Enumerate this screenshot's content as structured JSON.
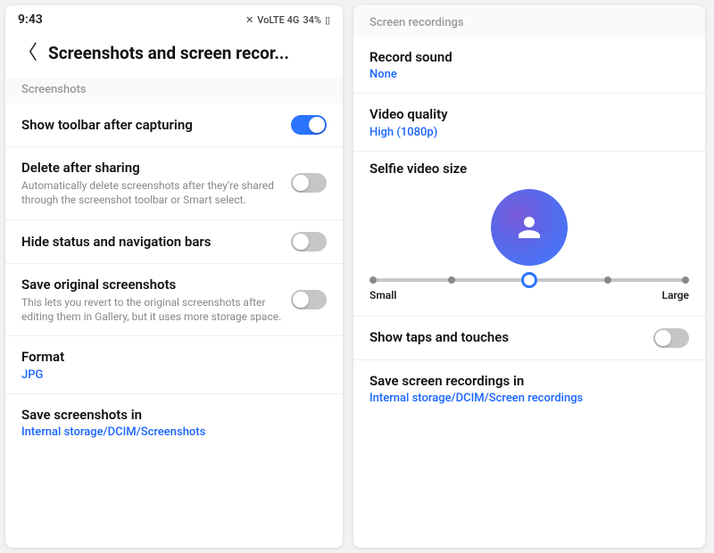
{
  "status": {
    "time": "9:43",
    "battery": "34%",
    "indicators": "VoLTE 4G"
  },
  "left": {
    "title": "Screenshots and screen recor...",
    "section_screenshots": "Screenshots",
    "show_toolbar": {
      "label": "Show toolbar after capturing",
      "on": true
    },
    "delete_sharing": {
      "label": "Delete after sharing",
      "desc": "Automatically delete screenshots after they're shared through the screenshot toolbar or Smart select.",
      "on": false
    },
    "hide_bars": {
      "label": "Hide status and navigation bars",
      "on": false
    },
    "save_original": {
      "label": "Save original screenshots",
      "desc": "This lets you revert to the original screenshots after editing them in Gallery, but it uses more storage space.",
      "on": false
    },
    "format": {
      "label": "Format",
      "value": "JPG"
    },
    "save_in": {
      "label": "Save screenshots in",
      "value": "Internal storage/DCIM/Screenshots"
    }
  },
  "right": {
    "section_recordings": "Screen recordings",
    "record_sound": {
      "label": "Record sound",
      "value": "None"
    },
    "video_quality": {
      "label": "Video quality",
      "value": "High (1080p)"
    },
    "selfie": {
      "label": "Selfie video size",
      "min_label": "Small",
      "max_label": "Large",
      "ticks": 5,
      "selected_index": 2
    },
    "show_taps": {
      "label": "Show taps and touches",
      "on": false
    },
    "save_in": {
      "label": "Save screen recordings in",
      "value": "Internal storage/DCIM/Screen recordings"
    }
  }
}
